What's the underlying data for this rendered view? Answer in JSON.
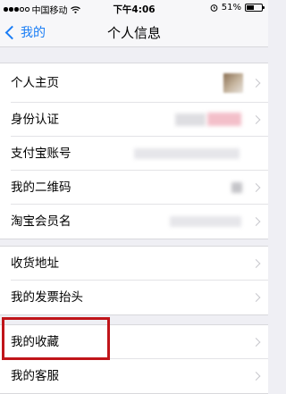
{
  "status_bar": {
    "carrier": "中国移动",
    "time": "下午4:06",
    "battery": "51%",
    "battery_level": 0.51,
    "icons": [
      "signal-dots-icon",
      "wifi-icon",
      "alarm-icon",
      "battery-icon"
    ]
  },
  "nav": {
    "back_label": "我的",
    "title": "个人信息"
  },
  "group1": [
    {
      "label": "个人主页"
    },
    {
      "label": "身份认证"
    },
    {
      "label": "支付宝账号"
    },
    {
      "label": "我的二维码"
    },
    {
      "label": "淘宝会员名"
    }
  ],
  "group2": [
    {
      "label": "收货地址"
    },
    {
      "label": "我的发票抬头"
    }
  ],
  "group3": [
    {
      "label": "我的收藏"
    },
    {
      "label": "我的客服"
    }
  ],
  "colors": {
    "accent": "#1a7df5",
    "highlight": "#c0151a",
    "background": "#efeff4"
  }
}
